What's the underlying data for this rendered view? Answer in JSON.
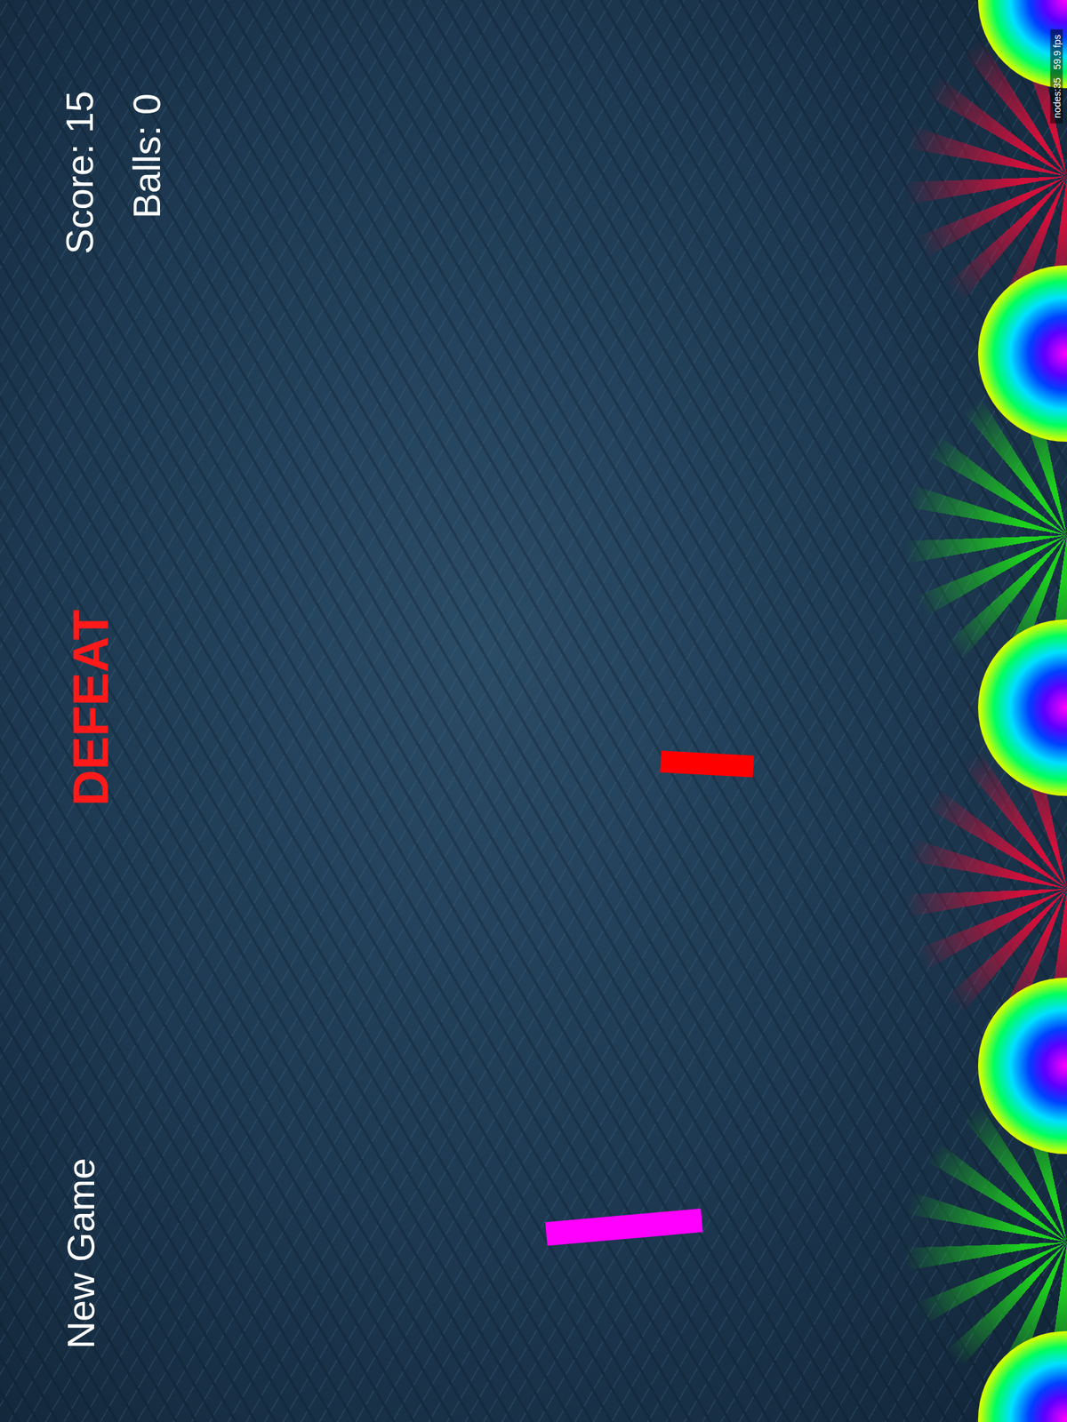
{
  "hud": {
    "score": "Score: 15",
    "balls": "Balls: 0"
  },
  "status": {
    "message": "DEFEAT"
  },
  "menu": {
    "new_game": "New Game"
  },
  "debug": {
    "nodes": "nodes:35",
    "fps": "59.9 fps"
  },
  "bursts": [
    {
      "color": "#d0103a"
    },
    {
      "color": "#1ed01e"
    },
    {
      "color": "#d0103a"
    },
    {
      "color": "#1ed01e"
    }
  ],
  "paddles": [
    {
      "color": "#ff0000"
    },
    {
      "color": "#ff00ff"
    }
  ]
}
